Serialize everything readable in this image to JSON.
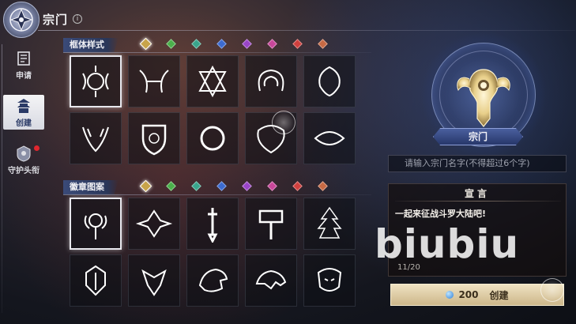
{
  "header": {
    "title": "宗门",
    "info_glyph": "i"
  },
  "nav": {
    "items": [
      {
        "label": "申请",
        "icon": "scroll-icon",
        "active": false
      },
      {
        "label": "创建",
        "icon": "pagoda-icon",
        "active": true
      },
      {
        "label": "守护头衔",
        "icon": "guardian-icon",
        "active": false,
        "badge": true
      }
    ]
  },
  "frame_section": {
    "title": "框体样式",
    "gems": [
      "#c8a44a",
      "#4bb04b",
      "#39a58c",
      "#3c6bd0",
      "#9a45c8",
      "#c8479a",
      "#d0403e",
      "#c86a44"
    ],
    "selected_gem": 0,
    "selected_index": 0,
    "count": 10
  },
  "badge_section": {
    "title": "徽章图案",
    "gems": [
      "#c8a44a",
      "#4bb04b",
      "#39a58c",
      "#3c6bd0",
      "#9a45c8",
      "#c8479a",
      "#d0403e",
      "#c86a44"
    ],
    "selected_gem": 0,
    "selected_index": 0,
    "count": 10
  },
  "preview": {
    "sect_name": "宗门",
    "name_placeholder": "请输入宗门名字(不得超过6个字)"
  },
  "declaration": {
    "title": "宣言",
    "text": "一起来征战斗罗大陆吧!",
    "count": "11/20"
  },
  "watermark": "biubiu",
  "create_button": {
    "cost": "200",
    "label": "创建",
    "currency_icon": "diamond-icon"
  }
}
